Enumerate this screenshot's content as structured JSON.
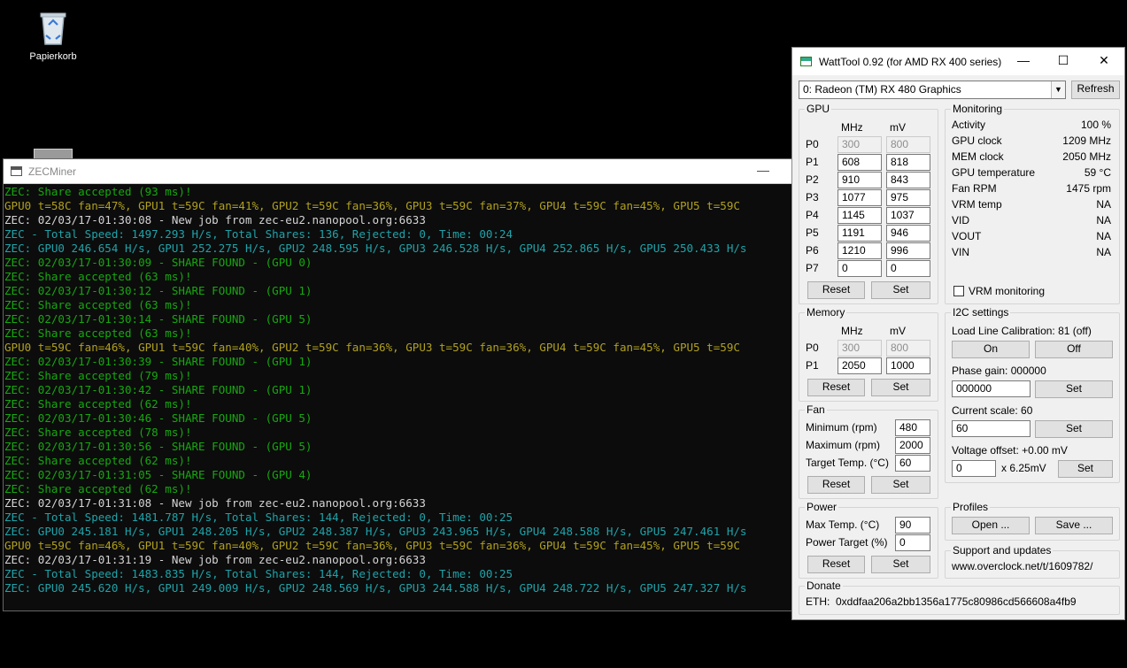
{
  "desktop": {
    "recycle_bin_label": "Papierkorb"
  },
  "console": {
    "title": "ZECMiner",
    "lines": [
      {
        "text": "ZEC: Share accepted (93 ms)!",
        "color": "green"
      },
      {
        "text": "GPU0 t=58C fan=47%, GPU1 t=59C fan=41%, GPU2 t=59C fan=36%, GPU3 t=59C fan=37%, GPU4 t=59C fan=45%, GPU5 t=59C",
        "color": "gold"
      },
      {
        "text": "ZEC: 02/03/17-01:30:08 - New job from zec-eu2.nanopool.org:6633",
        "color": "white"
      },
      {
        "text": "ZEC - Total Speed: 1497.293 H/s, Total Shares: 136, Rejected: 0, Time: 00:24",
        "color": "teal"
      },
      {
        "text": "ZEC: GPU0 246.654 H/s, GPU1 252.275 H/s, GPU2 248.595 H/s, GPU3 246.528 H/s, GPU4 252.865 H/s, GPU5 250.433 H/s",
        "color": "teal"
      },
      {
        "text": "ZEC: 02/03/17-01:30:09 - SHARE FOUND - (GPU 0)",
        "color": "green"
      },
      {
        "text": "ZEC: Share accepted (63 ms)!",
        "color": "green"
      },
      {
        "text": "ZEC: 02/03/17-01:30:12 - SHARE FOUND - (GPU 1)",
        "color": "green"
      },
      {
        "text": "ZEC: Share accepted (63 ms)!",
        "color": "green"
      },
      {
        "text": "ZEC: 02/03/17-01:30:14 - SHARE FOUND - (GPU 5)",
        "color": "green"
      },
      {
        "text": "ZEC: Share accepted (63 ms)!",
        "color": "green"
      },
      {
        "text": "GPU0 t=59C fan=46%, GPU1 t=59C fan=40%, GPU2 t=59C fan=36%, GPU3 t=59C fan=36%, GPU4 t=59C fan=45%, GPU5 t=59C",
        "color": "gold"
      },
      {
        "text": "ZEC: 02/03/17-01:30:39 - SHARE FOUND - (GPU 1)",
        "color": "green"
      },
      {
        "text": "ZEC: Share accepted (79 ms)!",
        "color": "green"
      },
      {
        "text": "ZEC: 02/03/17-01:30:42 - SHARE FOUND - (GPU 1)",
        "color": "green"
      },
      {
        "text": "ZEC: Share accepted (62 ms)!",
        "color": "green"
      },
      {
        "text": "ZEC: 02/03/17-01:30:46 - SHARE FOUND - (GPU 5)",
        "color": "green"
      },
      {
        "text": "ZEC: Share accepted (78 ms)!",
        "color": "green"
      },
      {
        "text": "ZEC: 02/03/17-01:30:56 - SHARE FOUND - (GPU 5)",
        "color": "green"
      },
      {
        "text": "ZEC: Share accepted (62 ms)!",
        "color": "green"
      },
      {
        "text": "ZEC: 02/03/17-01:31:05 - SHARE FOUND - (GPU 4)",
        "color": "green"
      },
      {
        "text": "ZEC: Share accepted (62 ms)!",
        "color": "green"
      },
      {
        "text": "ZEC: 02/03/17-01:31:08 - New job from zec-eu2.nanopool.org:6633",
        "color": "white"
      },
      {
        "text": "ZEC - Total Speed: 1481.787 H/s, Total Shares: 144, Rejected: 0, Time: 00:25",
        "color": "teal"
      },
      {
        "text": "ZEC: GPU0 245.181 H/s, GPU1 248.205 H/s, GPU2 248.387 H/s, GPU3 243.965 H/s, GPU4 248.588 H/s, GPU5 247.461 H/s",
        "color": "teal"
      },
      {
        "text": "GPU0 t=59C fan=46%, GPU1 t=59C fan=40%, GPU2 t=59C fan=36%, GPU3 t=59C fan=36%, GPU4 t=59C fan=45%, GPU5 t=59C",
        "color": "gold"
      },
      {
        "text": "ZEC: 02/03/17-01:31:19 - New job from zec-eu2.nanopool.org:6633",
        "color": "white"
      },
      {
        "text": "ZEC - Total Speed: 1483.835 H/s, Total Shares: 144, Rejected: 0, Time: 00:25",
        "color": "teal"
      },
      {
        "text": "ZEC: GPU0 245.620 H/s, GPU1 249.009 H/s, GPU2 248.569 H/s, GPU3 244.588 H/s, GPU4 248.722 H/s, GPU5 247.327 H/s",
        "color": "teal"
      }
    ],
    "colors": {
      "green": "#16a80f",
      "gold": "#b0a021",
      "white": "#d4d4d4",
      "teal": "#1fa3a9"
    }
  },
  "watt": {
    "title": "WattTool 0.92 (for AMD RX 400 series)",
    "device": "0: Radeon (TM) RX 480 Graphics",
    "refresh": "Refresh",
    "gpu": {
      "legend": "GPU",
      "mhz": "MHz",
      "mv": "mV",
      "states": [
        {
          "p": "P0",
          "mhz": "300",
          "mv": "800"
        },
        {
          "p": "P1",
          "mhz": "608",
          "mv": "818"
        },
        {
          "p": "P2",
          "mhz": "910",
          "mv": "843"
        },
        {
          "p": "P3",
          "mhz": "1077",
          "mv": "975"
        },
        {
          "p": "P4",
          "mhz": "1145",
          "mv": "1037"
        },
        {
          "p": "P5",
          "mhz": "1191",
          "mv": "946"
        },
        {
          "p": "P6",
          "mhz": "1210",
          "mv": "996"
        },
        {
          "p": "P7",
          "mhz": "0",
          "mv": "0"
        }
      ],
      "reset": "Reset",
      "set": "Set"
    },
    "monitoring": {
      "legend": "Monitoring",
      "rows": [
        {
          "label": "Activity",
          "value": "100 %"
        },
        {
          "label": "GPU clock",
          "value": "1209 MHz"
        },
        {
          "label": "MEM clock",
          "value": "2050 MHz"
        },
        {
          "label": "GPU temperature",
          "value": "59 °C"
        },
        {
          "label": "Fan RPM",
          "value": "1475 rpm"
        },
        {
          "label": "VRM temp",
          "value": "NA"
        },
        {
          "label": "VID",
          "value": "NA"
        },
        {
          "label": "VOUT",
          "value": "NA"
        },
        {
          "label": "VIN",
          "value": "NA"
        }
      ],
      "vrm_label": "VRM monitoring"
    },
    "memory": {
      "legend": "Memory",
      "mhz": "MHz",
      "mv": "mV",
      "states": [
        {
          "p": "P0",
          "mhz": "300",
          "mv": "800"
        },
        {
          "p": "P1",
          "mhz": "2050",
          "mv": "1000"
        }
      ],
      "reset": "Reset",
      "set": "Set"
    },
    "i2c": {
      "legend": "I2C settings",
      "llc_label": "Load Line Calibration: 81 (off)",
      "on": "On",
      "off": "Off",
      "phase_label": "Phase gain: 000000",
      "phase_value": "000000",
      "scale_label": "Current scale: 60",
      "scale_value": "60",
      "voffset_label": "Voltage offset: +0.00 mV",
      "voffset_value": "0",
      "voffset_unit": "x 6.25mV",
      "set": "Set"
    },
    "fan": {
      "legend": "Fan",
      "min_label": "Minimum (rpm)",
      "min_value": "480",
      "max_label": "Maximum (rpm)",
      "max_value": "2000",
      "target_label": "Target Temp. (°C)",
      "target_value": "60",
      "reset": "Reset",
      "set": "Set"
    },
    "power": {
      "legend": "Power",
      "maxtemp_label": "Max Temp. (°C)",
      "maxtemp_value": "90",
      "target_label": "Power Target (%)",
      "target_value": "0",
      "reset": "Reset",
      "set": "Set"
    },
    "profiles": {
      "legend": "Profiles",
      "open": "Open ...",
      "save": "Save ..."
    },
    "support": {
      "legend": "Support and updates",
      "url": "www.overclock.net/t/1609782/"
    },
    "donate": {
      "legend": "Donate",
      "eth_label": "ETH:",
      "eth_address": "0xddfaa206a2bb1356a1775c80986cd566608a4fb9"
    }
  }
}
